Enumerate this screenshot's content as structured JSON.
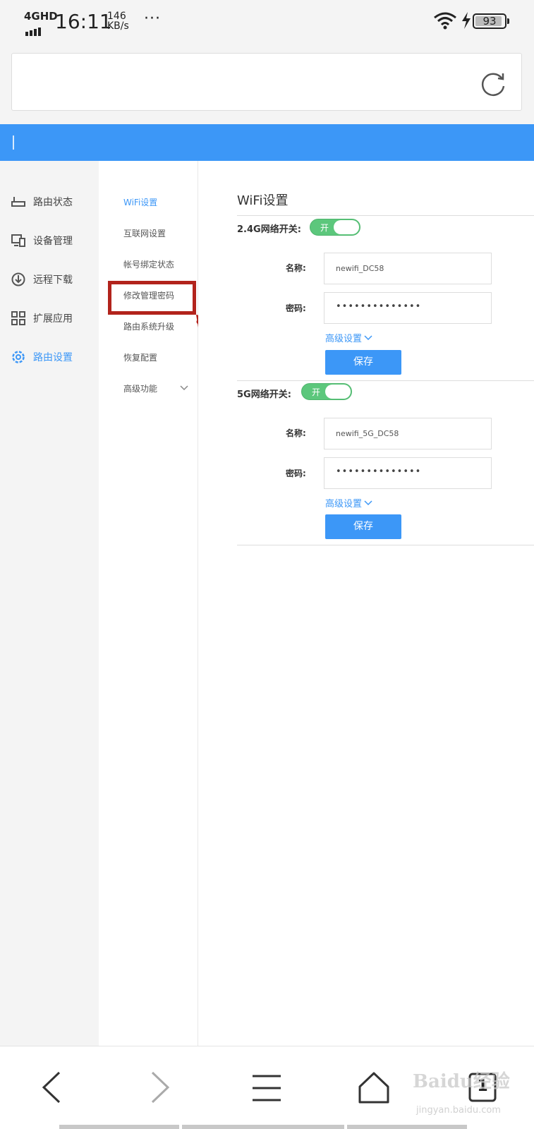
{
  "status_bar": {
    "network": "4GHD",
    "time": "16:11",
    "speed_value": "146",
    "speed_unit": "KB/s",
    "more": "···",
    "battery": "93",
    "battery_level": 0.93
  },
  "left_nav": {
    "items": [
      {
        "label": "路由状态",
        "icon": "router-icon"
      },
      {
        "label": "设备管理",
        "icon": "devices-icon"
      },
      {
        "label": "远程下载",
        "icon": "download-icon"
      },
      {
        "label": "扩展应用",
        "icon": "grid-icon"
      },
      {
        "label": "路由设置",
        "icon": "gear-icon",
        "active": true
      }
    ]
  },
  "sub_nav": {
    "items": [
      {
        "label": "WiFi设置",
        "active": true
      },
      {
        "label": "互联网设置"
      },
      {
        "label": "帐号绑定状态"
      },
      {
        "label": "修改管理密码"
      },
      {
        "label": "路由系统升级"
      },
      {
        "label": "恢复配置"
      },
      {
        "label": "高级功能"
      }
    ]
  },
  "main": {
    "title": "WiFi设置",
    "band_24": {
      "switch_label": "2.4G网络开关:",
      "toggle_text": "开",
      "name_label": "名称:",
      "name_value": "newifi_DC58",
      "password_label": "密码:",
      "password_value": "••••••••••••••",
      "advanced_label": "高级设置",
      "save_label": "保存"
    },
    "band_5": {
      "switch_label": "5G网络开关:",
      "toggle_text": "开",
      "name_label": "名称:",
      "name_value": "newifi_5G_DC58",
      "password_label": "密码:",
      "password_value": "••••••••••••••",
      "advanced_label": "高级设置",
      "save_label": "保存"
    }
  },
  "bottom_nav": {
    "tab_count": "1",
    "watermark": "Baidu经验",
    "watermark_url": "jingyan.baidu.com"
  },
  "colors": {
    "accent": "#3c97f7",
    "toggle_on": "#5cc77c",
    "annotation": "#b2231c"
  }
}
